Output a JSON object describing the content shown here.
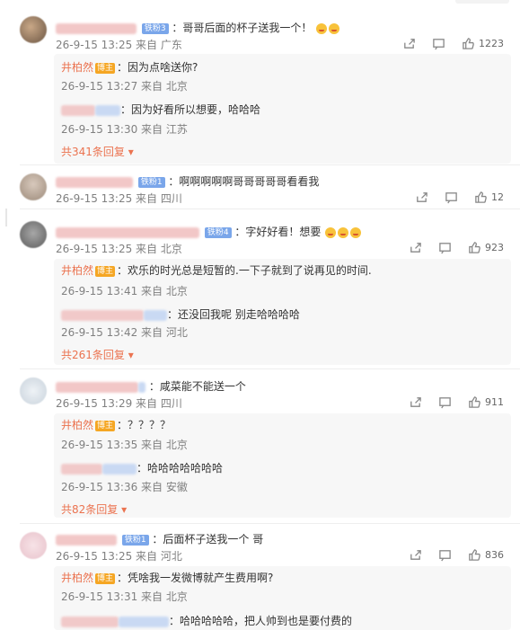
{
  "comments": [
    {
      "text": "：哥哥后面的杯子送我一个！",
      "badge": "铁粉3",
      "meta": "26-9-15 13:25 来自 广东",
      "likes": "1223",
      "replies": [
        {
          "name": "井柏然",
          "badge": "博主",
          "text": "：因为点啥送你?",
          "meta": "26-9-15 13:27 来自 北京"
        },
        {
          "name": "",
          "text": "：因为好看所以想要，哈哈哈",
          "meta": "26-9-15 13:30 来自 江苏"
        }
      ],
      "more": "共341条回复"
    },
    {
      "text": "：啊啊啊啊啊哥哥哥哥哥看看我",
      "badge": "铁粉1",
      "meta": "26-9-15 13:25 来自 四川",
      "likes": "12"
    },
    {
      "text": "：字好好看！想要",
      "badge": "铁粉4",
      "meta": "26-9-15 13:25 来自 北京",
      "likes": "923",
      "replies": [
        {
          "name": "井柏然",
          "badge": "博主",
          "text": "：欢乐的时光总是短暂的.一下子就到了说再见的时间.",
          "meta": "26-9-15 13:41 来自 北京"
        },
        {
          "name": "",
          "text": "：还没回我呢 别走哈哈哈哈",
          "meta": "26-9-15 13:42 来自 河北"
        }
      ],
      "more": "共261条回复"
    },
    {
      "text": "：咸菜能不能送一个",
      "meta": "26-9-15 13:29 来自 四川",
      "likes": "911",
      "replies": [
        {
          "name": "井柏然",
          "badge": "博主",
          "text": "：？？？？",
          "meta": "26-9-15 13:35 来自 北京"
        },
        {
          "name": "",
          "text": "：哈哈哈哈哈哈哈",
          "meta": "26-9-15 13:36 来自 安徽"
        }
      ],
      "more": "共82条回复"
    },
    {
      "text": "：后面杯子送我一个 哥",
      "badge": "铁粉1",
      "meta": "26-9-15 13:25 来自 河北",
      "likes": "836",
      "replies": [
        {
          "name": "井柏然",
          "badge": "博主",
          "text": "：凭啥我一发微博就产生费用啊?",
          "meta": "26-9-15 13:31 来自 北京"
        },
        {
          "name": "",
          "text": "：哈哈哈哈哈，把人帅到也是要付费的"
        }
      ]
    }
  ],
  "colors": {
    "accent": "#eb7350",
    "meta": "#808080",
    "badge_fan": "#7aa6ea",
    "badge_blogger": "#f5a623"
  },
  "icons": [
    "share-icon",
    "comment-icon",
    "like-icon",
    "chevron-down-icon"
  ]
}
